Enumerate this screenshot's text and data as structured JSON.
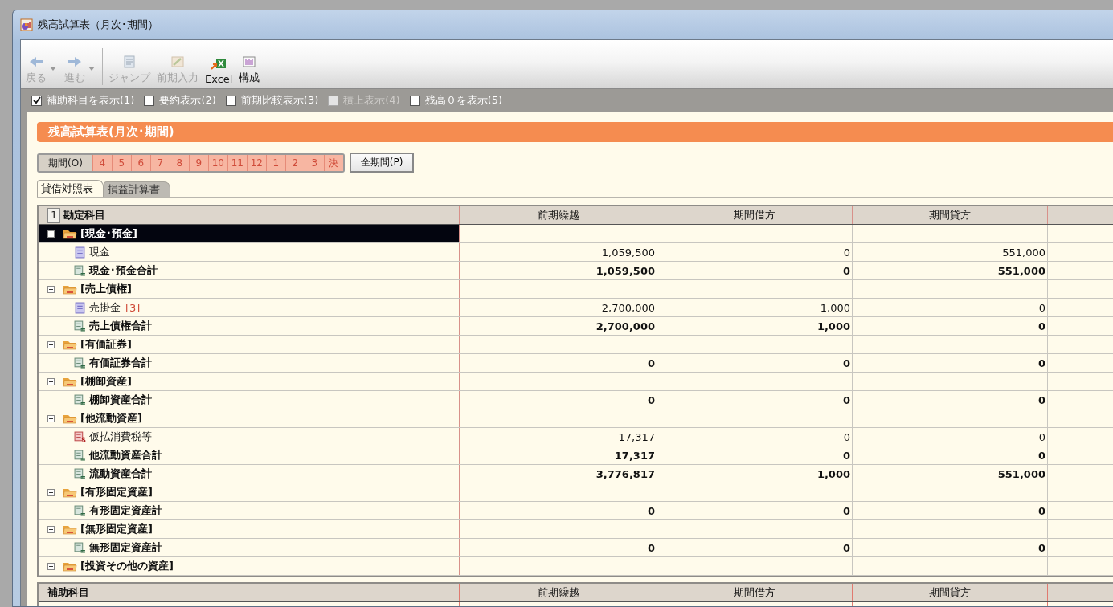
{
  "window": {
    "title": "残高試算表（月次･期間）"
  },
  "toolbar": [
    {
      "label": "戻る",
      "kind": "back",
      "disabled": true,
      "dropdown": true
    },
    {
      "label": "進む",
      "kind": "forward",
      "disabled": true,
      "dropdown": true
    },
    {
      "label": "ジャンプ",
      "kind": "jump",
      "disabled": true,
      "dropdown": false
    },
    {
      "label": "前期入力",
      "kind": "pencil",
      "disabled": true,
      "dropdown": false
    },
    {
      "label": "Excel",
      "kind": "excel",
      "disabled": false,
      "dropdown": false
    },
    {
      "label": "構成",
      "kind": "layout",
      "disabled": false,
      "dropdown": false
    }
  ],
  "options": [
    {
      "label": "補助科目を表示(1)",
      "checked": true,
      "disabled": false
    },
    {
      "label": "要約表示(2)",
      "checked": false,
      "disabled": false
    },
    {
      "label": "前期比較表示(3)",
      "checked": false,
      "disabled": false
    },
    {
      "label": "積上表示(4)",
      "checked": false,
      "disabled": true
    },
    {
      "label": "残高０を表示(5)",
      "checked": false,
      "disabled": false
    }
  ],
  "heading": "残高試算表(月次･期間)",
  "period_bar": {
    "label": "期間(O)",
    "periods": [
      {
        "label": "4",
        "selected": false
      },
      {
        "label": "5",
        "selected": false
      },
      {
        "label": "6",
        "selected": false
      },
      {
        "label": "7",
        "selected": false
      },
      {
        "label": "8",
        "selected": false
      },
      {
        "label": "9",
        "selected": false
      },
      {
        "label": "10",
        "selected": false
      },
      {
        "label": "11",
        "selected": false
      },
      {
        "label": "12",
        "selected": false
      },
      {
        "label": "1",
        "selected": false
      },
      {
        "label": "2",
        "selected": false
      },
      {
        "label": "3",
        "selected": false
      },
      {
        "label": "決",
        "selected": false
      }
    ],
    "all_button": "全期間(P)"
  },
  "tabs": [
    {
      "label": "貸借対照表",
      "selected": true
    },
    {
      "label": "損益計算書",
      "selected": false
    }
  ],
  "table": {
    "corner": "1",
    "columns": [
      "勘定科目",
      "前期繰越",
      "期間借方",
      "期間貸方"
    ],
    "tree": [
      {
        "label": "[現金･預金]",
        "selected": true,
        "expanded": true,
        "children": [
          {
            "label": "現金",
            "kind": "account",
            "selected": false,
            "values": [
              "1,059,500",
              "0",
              "551,000"
            ]
          },
          {
            "label": "現金･預金合計",
            "kind": "total",
            "selected": false,
            "values": [
              "1,059,500",
              "0",
              "551,000"
            ]
          }
        ]
      },
      {
        "label": "[売上債権]",
        "selected": false,
        "expanded": true,
        "children": [
          {
            "label": "売掛金",
            "badge": "[3]",
            "kind": "account",
            "selected": false,
            "values": [
              "2,700,000",
              "1,000",
              "0"
            ]
          },
          {
            "label": "売上債権合計",
            "kind": "total",
            "selected": false,
            "values": [
              "2,700,000",
              "1,000",
              "0"
            ]
          }
        ]
      },
      {
        "label": "[有価証券]",
        "selected": false,
        "expanded": true,
        "children": [
          {
            "label": "有価証券合計",
            "kind": "total",
            "selected": false,
            "values": [
              "0",
              "0",
              "0"
            ]
          }
        ]
      },
      {
        "label": "[棚卸資産]",
        "selected": false,
        "expanded": true,
        "children": [
          {
            "label": "棚卸資産合計",
            "kind": "total",
            "selected": false,
            "values": [
              "0",
              "0",
              "0"
            ]
          }
        ]
      },
      {
        "label": "[他流動資産]",
        "selected": false,
        "expanded": true,
        "children": [
          {
            "label": "仮払消費税等",
            "kind": "tax",
            "selected": false,
            "values": [
              "17,317",
              "0",
              "0"
            ]
          },
          {
            "label": "他流動資産合計",
            "kind": "total",
            "selected": false,
            "values": [
              "17,317",
              "0",
              "0"
            ]
          },
          {
            "label": "流動資産合計",
            "kind": "total",
            "selected": false,
            "values": [
              "3,776,817",
              "1,000",
              "551,000"
            ]
          }
        ]
      },
      {
        "label": "[有形固定資産]",
        "selected": false,
        "expanded": true,
        "children": [
          {
            "label": "有形固定資産計",
            "kind": "total",
            "selected": false,
            "values": [
              "0",
              "0",
              "0"
            ]
          }
        ]
      },
      {
        "label": "[無形固定資産]",
        "selected": false,
        "expanded": true,
        "children": [
          {
            "label": "無形固定資産計",
            "kind": "total",
            "selected": false,
            "values": [
              "0",
              "0",
              "0"
            ]
          }
        ]
      },
      {
        "label": "[投資その他の資産]",
        "selected": false,
        "expanded": true
      }
    ]
  },
  "sub_table": {
    "columns": [
      "補助科目",
      "前期繰越",
      "期間借方",
      "期間貸方"
    ]
  }
}
